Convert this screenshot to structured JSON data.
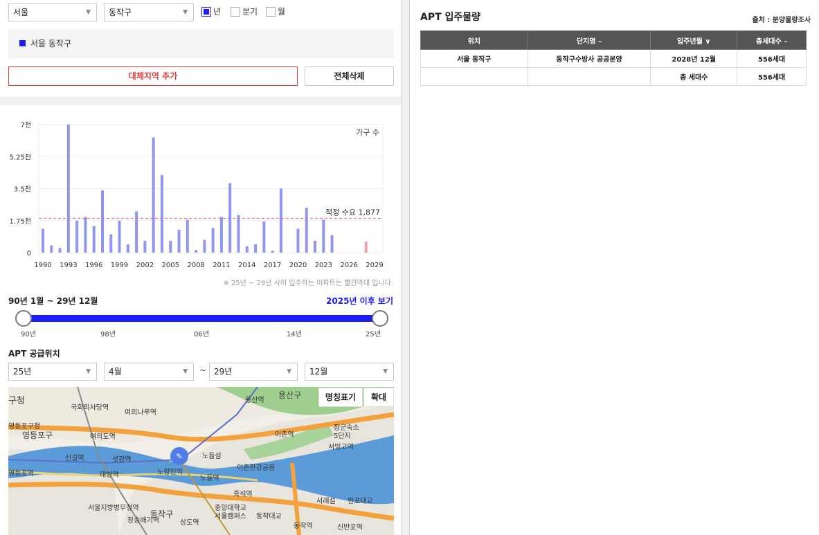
{
  "filters": {
    "city": "서울",
    "district": "동작구",
    "period_options": [
      {
        "label": "년",
        "checked": true
      },
      {
        "label": "분기",
        "checked": false
      },
      {
        "label": "월",
        "checked": false
      }
    ]
  },
  "region_list": [
    "서울 동작구"
  ],
  "buttons": {
    "add_region": "대체지역 추가",
    "delete_all": "전체삭제"
  },
  "chart_data": {
    "type": "bar",
    "legend": "가구 수",
    "reference_line": {
      "label": "적정 수요 1,877",
      "value": 1877
    },
    "y_ticks": [
      "7천",
      "5.25천",
      "3.5천",
      "1.75천",
      "0"
    ],
    "ylim": [
      0,
      7000
    ],
    "x_ticks": [
      "1990",
      "1993",
      "1996",
      "1999",
      "2002",
      "2005",
      "2008",
      "2011",
      "2014",
      "2017",
      "2020",
      "2023",
      "2026",
      "2029"
    ],
    "categories": [
      "1990",
      "1991",
      "1992",
      "1993",
      "1994",
      "1995",
      "1996",
      "1997",
      "1998",
      "1999",
      "2000",
      "2001",
      "2002",
      "2003",
      "2004",
      "2005",
      "2006",
      "2007",
      "2008",
      "2009",
      "2010",
      "2011",
      "2012",
      "2013",
      "2014",
      "2015",
      "2016",
      "2017",
      "2018",
      "2019",
      "2020",
      "2021",
      "2022",
      "2023",
      "2024",
      "2025",
      "2026",
      "2027",
      "2028"
    ],
    "values": [
      1300,
      400,
      250,
      7000,
      1750,
      1950,
      1450,
      3400,
      1000,
      1750,
      450,
      2250,
      650,
      6300,
      4250,
      650,
      1250,
      1800,
      150,
      700,
      1350,
      1950,
      3800,
      2050,
      350,
      450,
      1700,
      100,
      3500,
      0,
      1300,
      2450,
      650,
      1800,
      950,
      0,
      0,
      0,
      600
    ],
    "highlight_color": "#f2a1a6",
    "bar_color": "#8f98ee",
    "highlight_from": "2025"
  },
  "chart_note": "※ 25년 ~ 29년 사이 입주하는 아파트는 빨간막대 입니다.",
  "range": {
    "label": "90년 1월 ~ 29년 12월",
    "after_link": "2025년 이후 보기",
    "ticks": [
      "90년",
      "98년",
      "06년",
      "14년",
      "25년"
    ]
  },
  "supply": {
    "title": "APT 공급위치",
    "from_year": "25년",
    "from_month": "4월",
    "tilde": "~",
    "to_year": "29년",
    "to_month": "12월"
  },
  "map": {
    "btn_names": "명칭표기",
    "btn_zoom": "확대",
    "labels": [
      "용산구",
      "용산역",
      "국회의사당역",
      "여의나루역",
      "여의도역",
      "영등포구",
      "영등포구청",
      "신길역",
      "샛강역",
      "대방역",
      "노량진역",
      "노들역",
      "노들섬",
      "이촌역",
      "이촌한강공원",
      "서빙고역",
      "장군숙소",
      "5단지",
      "흑석역",
      "서울지방병무청역",
      "장승배기역",
      "상도역",
      "동작구",
      "중앙대학교",
      "서울캠퍼스",
      "동작대교",
      "동작역",
      "신반포역",
      "서래섬",
      "반포대교",
      "영등포역",
      "구청"
    ]
  },
  "right": {
    "title": "APT 입주물량",
    "source": "출처 : 분양물량조사",
    "columns": [
      "위치",
      "단지명 –",
      "입주년월 ∨",
      "총세대수 –"
    ],
    "rows": [
      [
        "서울 동작구",
        "동작구수방사 공공분양",
        "2028년 12월",
        "556세대"
      ]
    ],
    "total_label": "총 세대수",
    "total_value": "556세대"
  }
}
